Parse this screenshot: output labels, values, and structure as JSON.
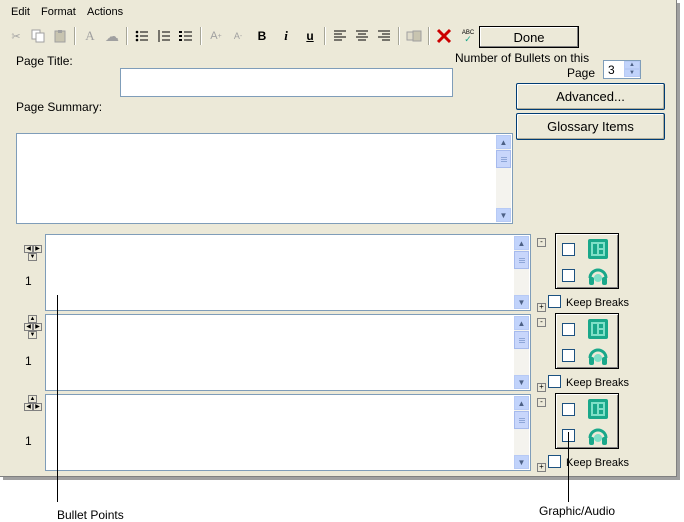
{
  "menu": {
    "edit": "Edit",
    "format": "Format",
    "actions": "Actions"
  },
  "toolbar": {
    "cut_icon": "scissors-icon",
    "copy_icon": "copy-icon",
    "paste_icon": "paste-icon",
    "font_glyph": "A",
    "bold": "B",
    "italic": "i",
    "underline": "u",
    "spell": "ABC",
    "done_label": "Done"
  },
  "page": {
    "title_label": "Page Title:",
    "title_value": "",
    "summary_label": "Page Summary:",
    "summary_value": "",
    "bullets_count_label_1": "Number of Bullets on this",
    "bullets_count_label_2": "Page",
    "bullets_count_value": "3",
    "advanced_label": "Advanced...",
    "glossary_label": "Glossary Items"
  },
  "bullets": [
    {
      "number": "1",
      "text": "",
      "keep_breaks": "Keep Breaks",
      "keep_breaks_checked": false
    },
    {
      "number": "1",
      "text": "",
      "keep_breaks": "Keep Breaks",
      "keep_breaks_checked": false
    },
    {
      "number": "1",
      "text": "",
      "keep_breaks": "Keep Breaks",
      "keep_breaks_checked": false
    }
  ],
  "callouts": {
    "bullet_points": "Bullet Points",
    "graphic_audio": "Graphic/Audio"
  },
  "colors": {
    "accent_teal": "#1aa88a",
    "window_bg": "#ece9d8",
    "scroll_blue": "#c1d3fb",
    "delete_red": "#cc0000"
  }
}
